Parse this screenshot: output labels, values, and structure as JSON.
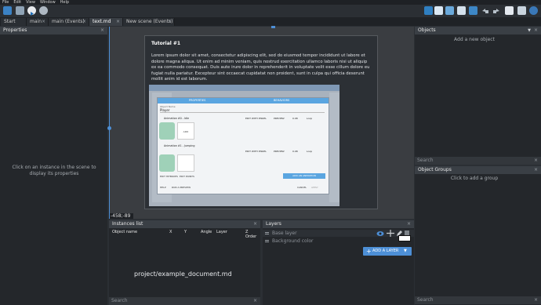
{
  "menu": [
    "File",
    "Edit",
    "View",
    "Window",
    "Help"
  ],
  "tabs": [
    {
      "label": "Start Page",
      "closable": false
    },
    {
      "label": "main",
      "closable": true
    },
    {
      "label": "main (Events)",
      "closable": true
    },
    {
      "label": "text.md",
      "closable": true,
      "active": true
    },
    {
      "label": "New scene (Events)",
      "closable": true
    }
  ],
  "properties": {
    "title": "Properties",
    "hint": "Click on an instance in the scene to display its properties"
  },
  "objects": {
    "title": "Objects",
    "add": "Add a new object",
    "search_placeholder": "Search"
  },
  "object_groups": {
    "title": "Object Groups",
    "add": "Click to add a group",
    "search_placeholder": "Search"
  },
  "scene": {
    "coords": "-458;-89",
    "tutorial_title": "Tutorial #1",
    "tutorial_body": "Lorem ipsum dolor sit amet, consectetur adipiscing elit, sed do eiusmod tempor incididunt ut labore et dolore magna aliqua. Ut enim ad minim veniam, quis nostrud exercitation ullamco laboris nisi ut aliquip ex ea commodo consequat. Duis aute irure dolor in reprehenderit in voluptate velit esse cillum dolore eu fugiat nulla pariatur. Excepteur sint occaecat cupidatat non proident, sunt in culpa qui officia deserunt mollit anim id est laborum."
  },
  "inner_dialog": {
    "tab_properties": "PROPERTIES",
    "tab_behaviors": "BEHAVIORS",
    "object_name_label": "Object Name",
    "object_name": "Player",
    "animation0": "Animation #0 - Idle",
    "animation1": "Animation #1 - Jumping",
    "edit_pixel": "EDIT WITH PISKEL",
    "preview": "PREVIEW",
    "speed": "0.08",
    "loop": "Loop",
    "add": "ADD",
    "edit_hitboxes": "EDIT HITBOXES",
    "edit_points": "EDIT POINTS",
    "add_animation": "ADD AN ANIMATION",
    "help": "HELP",
    "run_preview": "RUN A PREVIEW",
    "cancel": "CANCEL",
    "apply": "APPLY"
  },
  "instances": {
    "title": "Instances list",
    "columns": [
      "Object name",
      "X",
      "Y",
      "Angle",
      "Layer",
      "Z Order"
    ],
    "body_text": "project/example_document.md",
    "search_placeholder": "Search"
  },
  "layers": {
    "title": "Layers",
    "rows": [
      {
        "name": "Base layer"
      },
      {
        "name": "Background color"
      }
    ],
    "add_layer": "ADD A LAYER"
  },
  "colors": {
    "accent": "#4d8fd6",
    "tab_active": "#3a3f45"
  }
}
